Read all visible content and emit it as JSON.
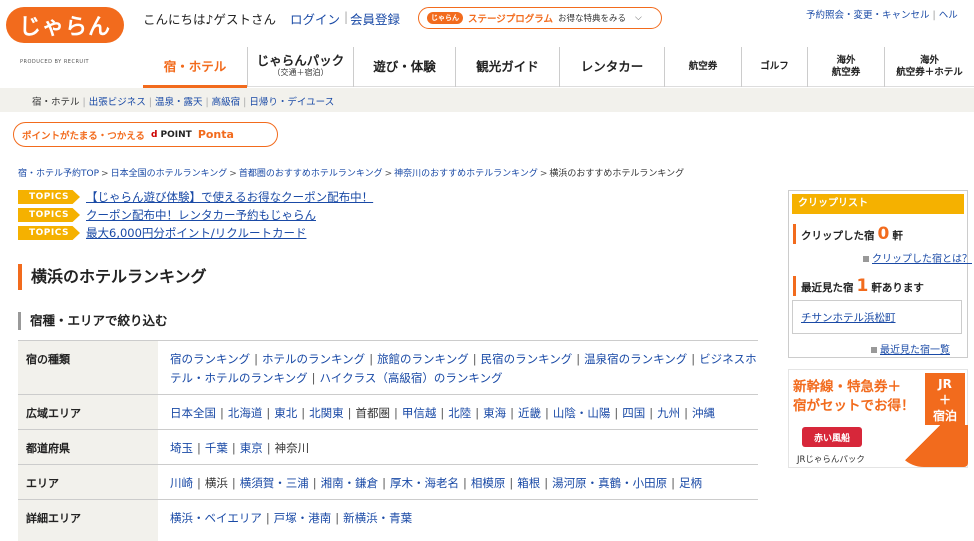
{
  "header": {
    "logo_text": "じゃらん",
    "logo_sub": "PRODUCED BY RECRUIT",
    "greeting": "こんにちは♪ゲストさん",
    "login": "ログイン",
    "register": "会員登録",
    "stage": {
      "logo": "じゃらん",
      "title": "ステージプログラム",
      "text": "お得な特典をみる"
    },
    "right_link_1": "予約照会・変更・キャンセル",
    "right_link_2": "ヘル"
  },
  "nav": {
    "items": [
      {
        "label": "宿・ホテル",
        "sub": ""
      },
      {
        "label": "じゃらんパック",
        "sub": "（交通＋宿泊）"
      },
      {
        "label": "遊び・体験",
        "sub": ""
      },
      {
        "label": "観光ガイド",
        "sub": ""
      },
      {
        "label": "レンタカー",
        "sub": ""
      },
      {
        "label": "航空券",
        "sub": ""
      },
      {
        "label": "ゴルフ",
        "sub": ""
      },
      {
        "label": "海外",
        "sub": "航空券"
      },
      {
        "label": "海外",
        "sub": "航空券＋ホテル"
      }
    ]
  },
  "subnav": {
    "current": "宿・ホテル",
    "items": [
      "出張ビジネス",
      "温泉・露天",
      "高級宿",
      "日帰り・デイユース"
    ]
  },
  "points": {
    "label": "ポイントがたまる・つかえる",
    "dpoint": "POINT",
    "ponta": "Ponta"
  },
  "breadcrumb": {
    "items": [
      "宿・ホテル予約TOP",
      "日本全国のホテルランキング",
      "首都圏のおすすめホテルランキング",
      "神奈川のおすすめホテルランキング"
    ],
    "current": "横浜のおすすめホテルランキング"
  },
  "topics": {
    "badge": "TOPICS",
    "items": [
      "【じゃらん遊び体験】で使えるお得なクーポン配布中！",
      "クーポン配布中！レンタカー予約もじゃらん",
      "最大6,000円分ポイント/リクルートカード"
    ]
  },
  "page_title": "横浜のホテルランキング",
  "section_title": "宿種・エリアで絞り込む",
  "filters": {
    "type": {
      "label": "宿の種類",
      "items": [
        "宿のランキング",
        "ホテルのランキング",
        "旅館のランキング",
        "民宿のランキング",
        "温泉宿のランキング",
        "ビジネスホテル・ホテルのランキング",
        "ハイクラス（高級宿）のランキング"
      ]
    },
    "wide": {
      "label": "広域エリア",
      "items": [
        "日本全国",
        "北海道",
        "東北",
        "北関東",
        "首都圏",
        "甲信越",
        "北陸",
        "東海",
        "近畿",
        "山陰・山陽",
        "四国",
        "九州",
        "沖縄"
      ]
    },
    "pref": {
      "label": "都道府県",
      "items": [
        "埼玉",
        "千葉",
        "東京",
        "神奈川"
      ]
    },
    "area": {
      "label": "エリア",
      "items": [
        "川崎",
        "横浜",
        "横須賀・三浦",
        "湘南・鎌倉",
        "厚木・海老名",
        "相模原",
        "箱根",
        "湯河原・真鶴・小田原",
        "足柄"
      ]
    },
    "detail": {
      "label": "詳細エリア",
      "items": [
        "横浜・ベイエリア",
        "戸塚・港南",
        "新横浜・青葉"
      ]
    }
  },
  "sidebar": {
    "clip_head": "クリップリスト",
    "clip_label": "クリップした宿",
    "clip_count": "0",
    "clip_unit": "軒",
    "clip_help": "クリップした宿とは？",
    "recent_label": "最近見た宿",
    "recent_count": "1",
    "recent_unit": "軒あります",
    "recent_hotel": "チサンホテル浜松町",
    "recent_list": "最近見た宿一覧"
  },
  "ad": {
    "line1": "新幹線・特急券＋",
    "line2": "宿がセットでお得！",
    "jr": "JR",
    "plus": "＋",
    "stay": "宿泊",
    "akai": "赤い風船",
    "sub": "JRじゃらんパック"
  },
  "colors": {
    "brand": "#f26b1d",
    "topics": "#f5b100",
    "link": "#1a4aa6"
  }
}
